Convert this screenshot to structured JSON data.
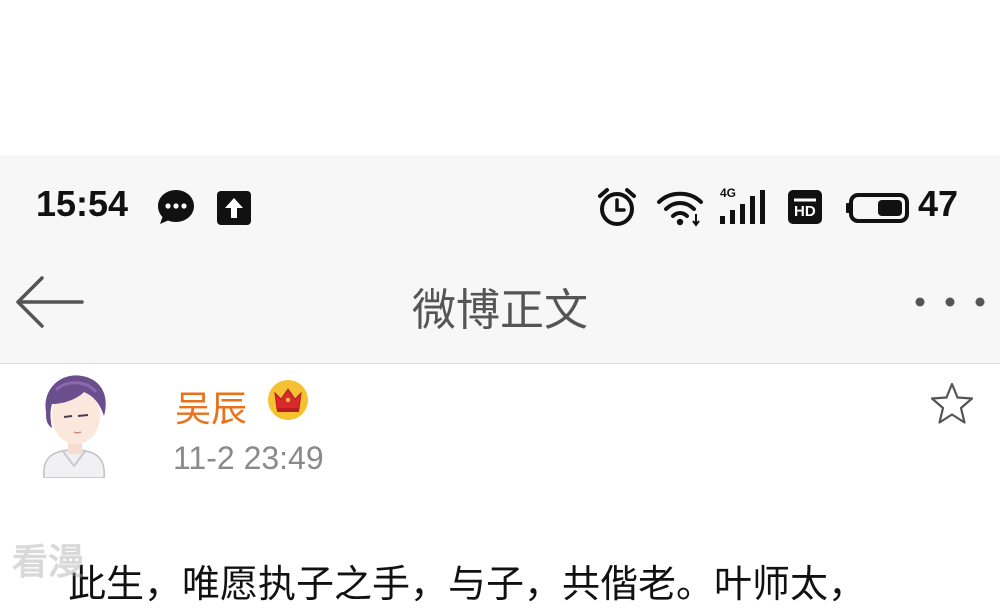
{
  "status_bar": {
    "time": "15:54",
    "network_label": "4G",
    "battery_level": "47",
    "icons": [
      "chat-bubble-icon",
      "upload-icon",
      "alarm-icon",
      "wifi-icon",
      "signal-icon",
      "hd-icon",
      "battery-icon"
    ]
  },
  "nav": {
    "title": "微博正文",
    "hd_label": "HD"
  },
  "post": {
    "author": "吴辰",
    "time": "11-2 23:49",
    "text": "此生，唯愿执子之手，与子，共偕老。叶师太，",
    "author_color": "#e8731c"
  },
  "watermark": "看漫"
}
